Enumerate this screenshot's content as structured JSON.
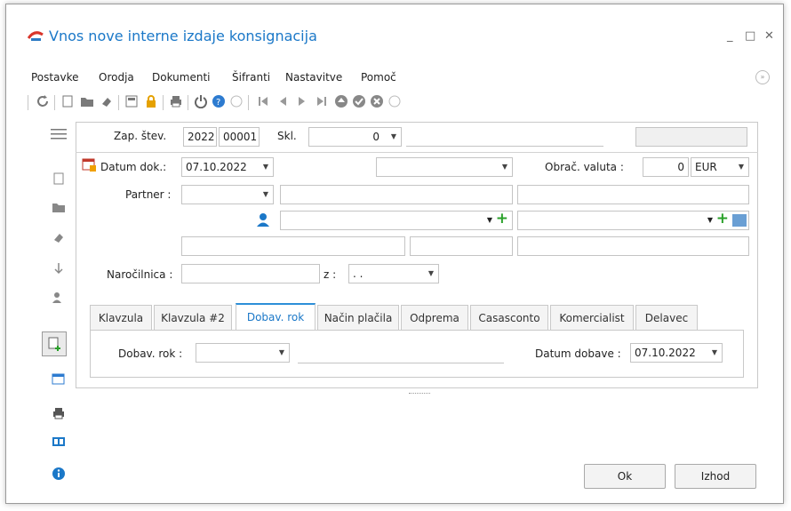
{
  "window": {
    "title": "Vnos nove interne izdaje konsignacija"
  },
  "menu": [
    "Postavke",
    "Orodja",
    "Dokumenti",
    "Šifranti",
    "Nastavitve",
    "Pomoč"
  ],
  "header": {
    "zap_label": "Zap. štev.",
    "zap_year": "2022",
    "zap_num": "00001",
    "skl_label": "Skl.",
    "skl_value": "0"
  },
  "form": {
    "datum_label": "Datum dok.:",
    "datum_value": "07.10.2022",
    "obrac_label": "Obrač. valuta :",
    "obrac_amount": "0",
    "obrac_currency": "EUR",
    "partner_label": "Partner :",
    "narocilnica_label": "Naročilnica :",
    "z_label": "z :",
    "z_value": ". ."
  },
  "tabs": [
    "Klavzula",
    "Klavzula #2",
    "Dobav. rok",
    "Način plačila",
    "Odprema",
    "Casasconto",
    "Komercialist",
    "Delavec"
  ],
  "tab_panel": {
    "dobav_rok_label": "Dobav. rok :",
    "datum_dobave_label": "Datum dobave :",
    "datum_dobave_value": "07.10.2022"
  },
  "buttons": {
    "ok": "Ok",
    "exit": "Izhod"
  },
  "colors": {
    "accent": "#1b78c8",
    "green": "#2aa12a"
  }
}
